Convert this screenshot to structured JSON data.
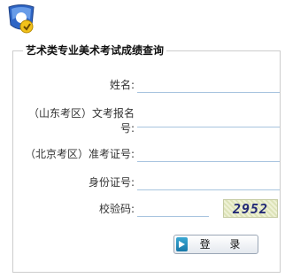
{
  "form": {
    "title": "艺术类专业美术考试成绩查询",
    "fields": [
      {
        "label": "姓名:"
      },
      {
        "label_line1": "（山东考区）文考报名",
        "label_line2": "号:"
      },
      {
        "label": "（北京考区）准考证号:"
      },
      {
        "label": "身份证号:"
      },
      {
        "label": "校验码:"
      }
    ],
    "captcha": "2952",
    "login_label": "登 录"
  },
  "icons": {
    "logo": "user-shield-logo-icon",
    "login": "arrow-right-icon"
  },
  "colors": {
    "field_underline": "#a8c4df",
    "login_icon": "#1f88bd",
    "captcha_text": "#232a76"
  }
}
